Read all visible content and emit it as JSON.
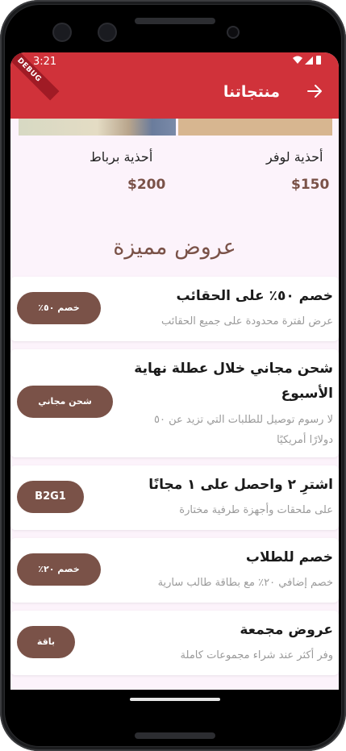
{
  "status": {
    "time": "3:21",
    "icons": "▼◢▮"
  },
  "appbar": {
    "title": "منتجاتنا",
    "debug_label": "DEBUG"
  },
  "products": [
    {
      "name": "أحذية لوفر",
      "price": "$150"
    },
    {
      "name": "أحذية برباط",
      "price": "$200"
    }
  ],
  "featured": {
    "title": "عروض مميزة",
    "offers": [
      {
        "title": "خصم ٥٠٪ على الحقائب",
        "subtitle": "عرض لفترة محدودة على جميع الحقائب",
        "badge": "خصم ٥٠٪"
      },
      {
        "title_line1": "شحن مجاني خلال عطلة نهاية",
        "title_line2": "الأسبوع",
        "subtitle_line1": "لا رسوم توصيل للطلبات التي تزيد عن ٥٠",
        "subtitle_line2": "دولارًا أمريكيًا",
        "badge": "شحن مجاني"
      },
      {
        "title": "اشترِ ٢ واحصل على ١ مجانًا",
        "subtitle": "على ملحقات وأجهزة طرفية مختارة",
        "badge": "B2G1"
      },
      {
        "title": "خصم للطلاب",
        "subtitle": "خصم إضافي ٢٠٪ مع بطاقة طالب سارية",
        "badge": "خصم ٢٠٪"
      },
      {
        "title": "عروض مجمعة",
        "subtitle": "وفر أكثر عند شراء مجموعات كاملة",
        "badge": "باقة"
      }
    ]
  },
  "colors": {
    "primary": "#d0323a",
    "accent": "#7a5248",
    "background": "#fcf3fb"
  }
}
